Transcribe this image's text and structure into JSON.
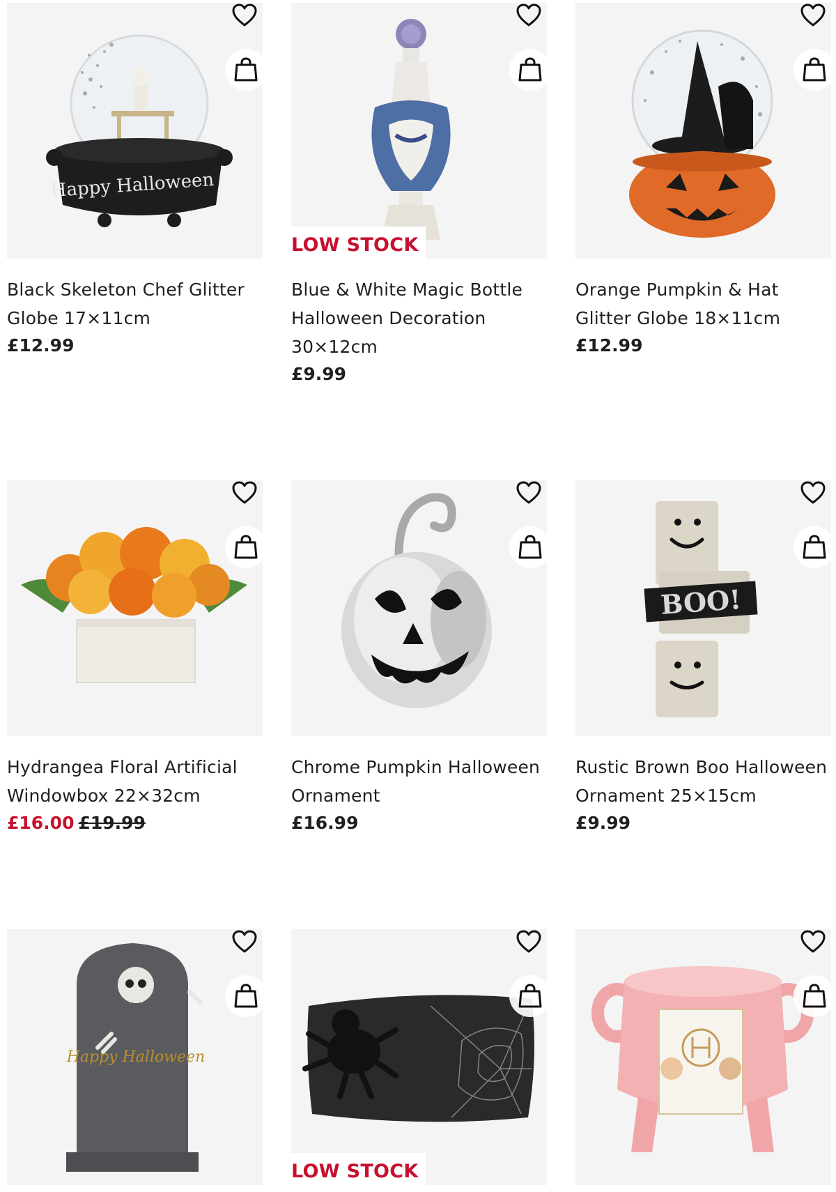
{
  "products": [
    {
      "name": "Black Skeleton Chef Glitter Globe 17×11cm",
      "price": "£12.99",
      "image_text": "Happy Halloween",
      "badge": ""
    },
    {
      "name": "Blue & White Magic Bottle Halloween Decoration 30×12cm",
      "price": "£9.99",
      "badge": "LOW STOCK"
    },
    {
      "name": "Orange Pumpkin & Hat Glitter Globe 18×11cm",
      "price": "£12.99",
      "badge": ""
    },
    {
      "name": "Hydrangea Floral Artificial Windowbox 22×32cm",
      "sale_price": "£16.00",
      "was_price": "£19.99",
      "badge": ""
    },
    {
      "name": "Chrome Pumpkin Halloween Ornament",
      "price": "£16.99",
      "badge": ""
    },
    {
      "name": "Rustic Brown Boo Halloween Ornament 25×15cm",
      "price": "£9.99",
      "image_text": "BOO!",
      "badge": ""
    },
    {
      "name": "",
      "price": "",
      "image_text": "Happy Halloween",
      "badge": ""
    },
    {
      "name": "",
      "price": "",
      "badge": "LOW STOCK"
    },
    {
      "name": "",
      "price": "",
      "badge": ""
    }
  ],
  "icons": {
    "wishlist": "heart-icon",
    "add_to_bag": "shopping-bag-icon"
  },
  "colors": {
    "accent_red": "#c8102e",
    "text": "#1f1f1f",
    "image_bg": "#f2f2f2"
  }
}
